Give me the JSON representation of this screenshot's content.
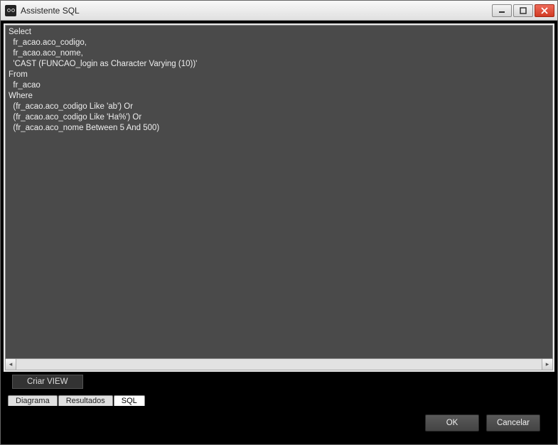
{
  "window": {
    "title": "Assistente SQL"
  },
  "editor": {
    "text": "Select\n  fr_acao.aco_codigo,\n  fr_acao.aco_nome,\n  'CAST (FUNCAO_login as Character Varying (10))'\nFrom\n  fr_acao\nWhere\n  (fr_acao.aco_codigo Like 'ab') Or\n  (fr_acao.aco_codigo Like 'Ha%') Or\n  (fr_acao.aco_nome Between 5 And 500)"
  },
  "toolbar": {
    "criar_view_label": "Criar VIEW"
  },
  "tabs": {
    "diagrama": "Diagrama",
    "resultados": "Resultados",
    "sql": "SQL"
  },
  "buttons": {
    "ok": "OK",
    "cancel": "Cancelar"
  }
}
